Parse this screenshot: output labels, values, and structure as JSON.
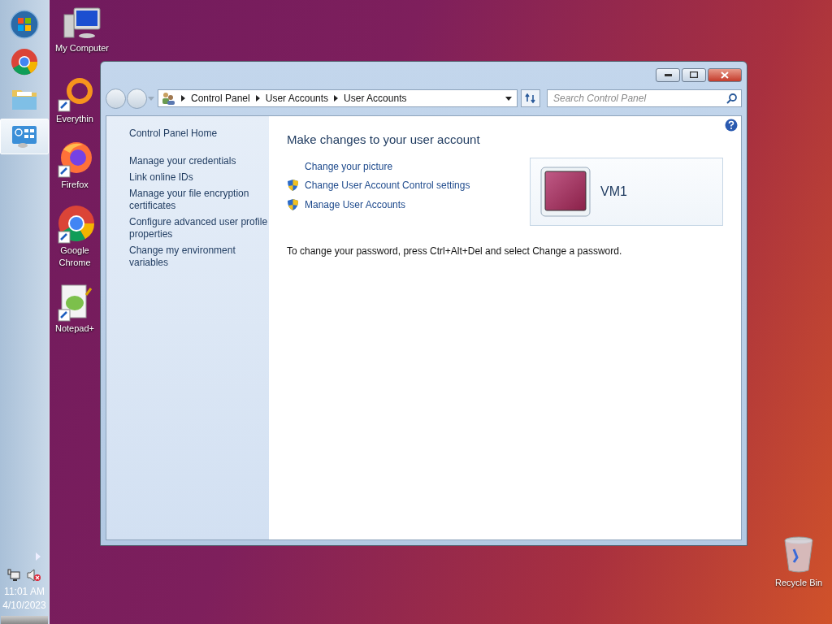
{
  "taskbar": {
    "buttons": [
      {
        "kind": "start",
        "selected": false
      },
      {
        "kind": "chrome",
        "selected": false
      },
      {
        "kind": "folder",
        "selected": false
      },
      {
        "kind": "control-panel",
        "selected": true
      }
    ],
    "time": "11:01 AM",
    "date": "4/10/2023"
  },
  "desktop_icons": [
    {
      "label": "My Computer",
      "kind": "computer"
    },
    {
      "label": "Everythin",
      "kind": "everything"
    },
    {
      "label": "Firefox",
      "kind": "firefox"
    },
    {
      "label": "Google Chrome",
      "kind": "chrome"
    },
    {
      "label": "Notepad+",
      "kind": "notepad"
    }
  ],
  "recycle_bin": {
    "label": "Recycle Bin"
  },
  "window": {
    "breadcrumb": [
      "Control Panel",
      "User Accounts",
      "User Accounts"
    ],
    "search": {
      "placeholder": "Search Control Panel"
    },
    "sidebar": {
      "home": "Control Panel Home",
      "links": [
        "Manage your credentials",
        "Link online IDs",
        "Manage your file encryption certificates",
        "Configure advanced user profile properties",
        "Change my environment variables"
      ]
    },
    "heading": "Make changes to your user account",
    "tasks": [
      {
        "label": "Change your picture",
        "shield": false
      },
      {
        "label": "Change User Account Control settings",
        "shield": true
      },
      {
        "label": "Manage User Accounts",
        "shield": true
      }
    ],
    "account": {
      "name": "VM1"
    },
    "note": "To change your password, press Ctrl+Alt+Del and select Change a password."
  }
}
